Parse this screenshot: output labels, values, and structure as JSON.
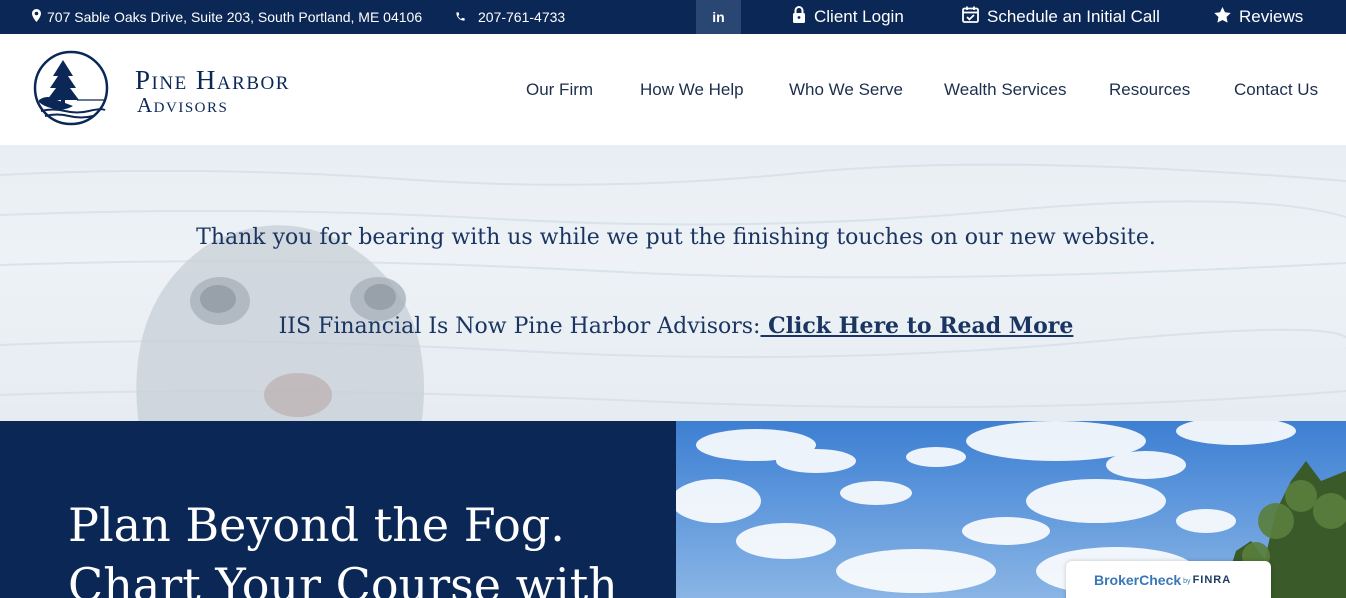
{
  "topbar": {
    "address": "707 Sable Oaks Drive, Suite 203, South Portland, ME 04106",
    "phone": "207-761-4733",
    "linkedin_label": "in",
    "client_login": "Client Login",
    "schedule": "Schedule an Initial Call",
    "reviews": "Reviews"
  },
  "logo": {
    "line1": "Pine Harbor",
    "line2": "Advisors"
  },
  "nav": {
    "items": [
      "Our Firm",
      "How We Help",
      "Who We Serve",
      "Wealth Services",
      "Resources",
      "Contact Us"
    ]
  },
  "banner": {
    "message": "Thank you for bearing with us while we put the finishing touches on our new website.",
    "notice_prefix": "IIS Financial Is Now Pine Harbor Advisors:",
    "notice_link": " Click Here to Read More"
  },
  "hero": {
    "line1": "Plan Beyond the Fog.",
    "line2": "Chart Your Course with"
  },
  "brokercheck": {
    "brand": "BrokerCheck",
    "by": "by",
    "finra": "FINRA"
  },
  "colors": {
    "navy": "#0b2756",
    "linkedin_bg": "#2a4673",
    "nav_text": "#1d2f4d",
    "banner_text": "#1a3561"
  },
  "icons": [
    "map-pin-icon",
    "phone-icon",
    "lock-icon",
    "calendar-check-icon",
    "star-icon",
    "pine-tree-logo-icon"
  ]
}
